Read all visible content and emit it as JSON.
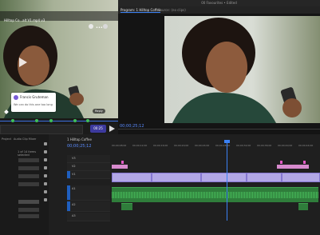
{
  "window": {
    "title": "00 Favourites • Edited"
  },
  "review": {
    "title": "Hilltop Co...alt V1.mp4 v3",
    "comment": {
      "author": "Francis Gruteman",
      "body": "We can do this one too long"
    },
    "reply_label": "Reply",
    "timecode": "00:25",
    "accent_color": "#3d3a9e"
  },
  "program": {
    "tabs": [
      "Program: 1 Hilltop Coffee",
      "Source: (no clips)",
      "Lumetri"
    ],
    "timecode": "00;00;25;12"
  },
  "project": {
    "tabs": [
      "Project",
      "Audio Clip Mixer",
      "Lib"
    ],
    "info": "1 of 14 items selected",
    "items": [
      "",
      "",
      "",
      "",
      "",
      "",
      ""
    ]
  },
  "timeline": {
    "sequence_tab": "1 Hilltop Coffee",
    "timecode": "00;00;25;12",
    "ruler_labels": [
      "00;00;08;00",
      "00;00;12;00",
      "00;00;16;00",
      "00;00;20;00",
      "00;00;24;00",
      "00;00;28;00",
      "00;00;32;00",
      "00;00;36;00",
      "00;00;40;00",
      "00;00;44;00"
    ],
    "tracks": [
      "V3",
      "V2",
      "V1",
      "A1",
      "A2",
      "A3"
    ],
    "playhead_color": "#3b82f6",
    "video_clip_color": "#b2a7e6",
    "audio_clip_color": "#2f7d3b"
  }
}
